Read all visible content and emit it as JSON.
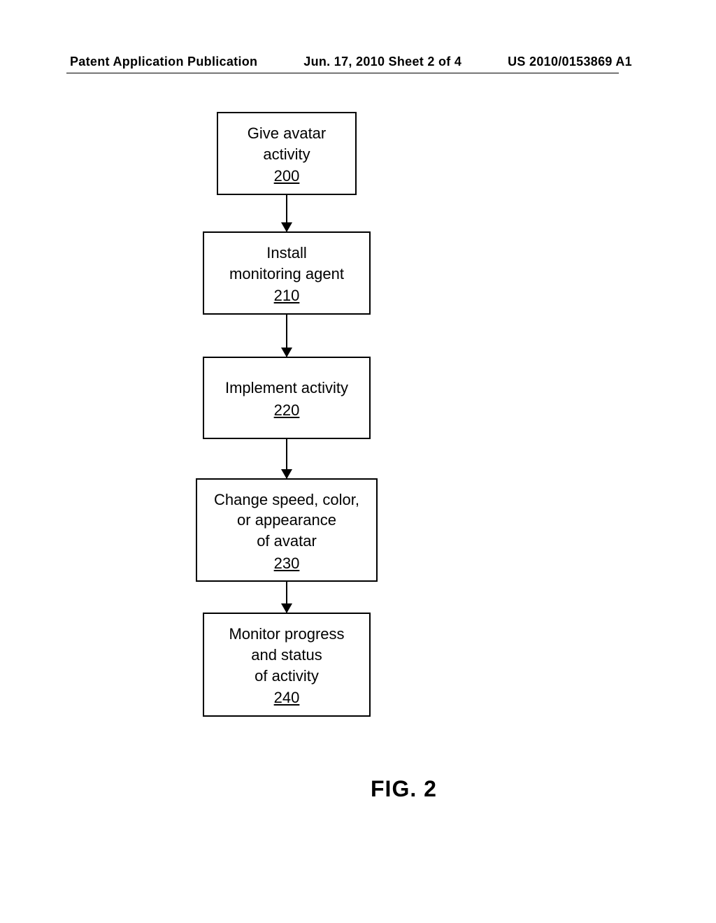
{
  "header": {
    "left": "Patent Application Publication",
    "center": "Jun. 17, 2010  Sheet 2 of 4",
    "right": "US 2010/0153869 A1"
  },
  "boxes": {
    "b1": {
      "line1": "Give avatar",
      "line2": "activity",
      "ref": "200"
    },
    "b2": {
      "line1": "Install",
      "line2": "monitoring agent",
      "ref": "210"
    },
    "b3": {
      "line1": "Implement activity",
      "ref": "220"
    },
    "b4": {
      "line1": "Change speed, color,",
      "line2": "or appearance",
      "line3": "of avatar",
      "ref": "230"
    },
    "b5": {
      "line1": "Monitor progress",
      "line2": "and status",
      "line3": "of activity",
      "ref": "240"
    }
  },
  "figure_label": "FIG. 2"
}
